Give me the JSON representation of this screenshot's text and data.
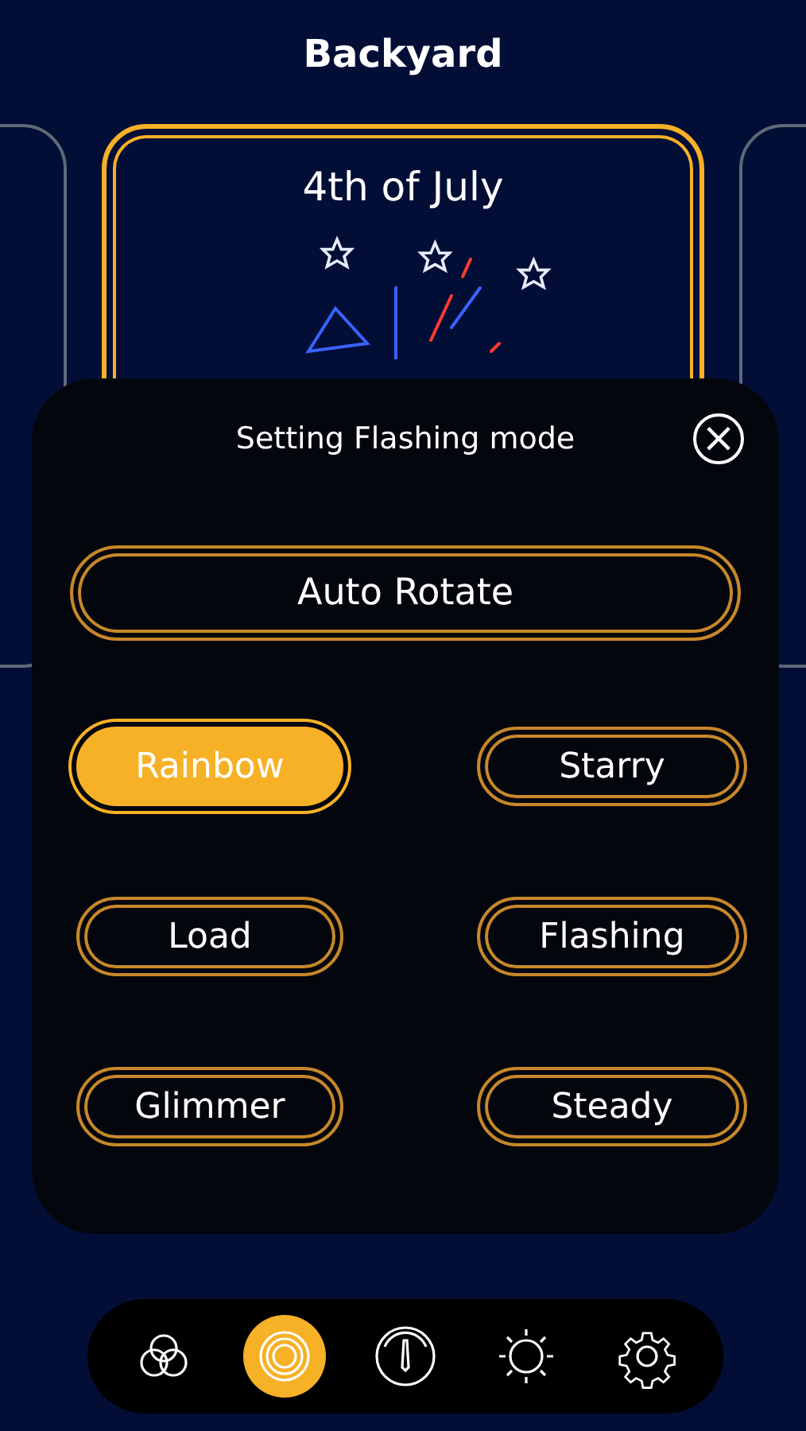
{
  "header": {
    "title": "Backyard"
  },
  "carousel": {
    "cards": [
      {
        "kind": "side"
      },
      {
        "kind": "center",
        "title": "4th of July",
        "selected": true
      },
      {
        "kind": "side"
      }
    ]
  },
  "modal": {
    "title": "Setting Flashing mode",
    "close_icon": "×",
    "primary": {
      "label": "Auto Rotate",
      "selected": false
    },
    "modes": [
      {
        "label": "Rainbow",
        "selected": true
      },
      {
        "label": "Starry",
        "selected": false
      },
      {
        "label": "Load",
        "selected": false
      },
      {
        "label": "Flashing",
        "selected": false
      },
      {
        "label": "Glimmer",
        "selected": false
      },
      {
        "label": "Steady",
        "selected": false
      }
    ]
  },
  "nav": [
    {
      "kind": "colors",
      "selected": false
    },
    {
      "kind": "modes",
      "selected": true
    },
    {
      "kind": "speed",
      "selected": false
    },
    {
      "kind": "brightness",
      "selected": false
    },
    {
      "kind": "settings",
      "selected": false
    }
  ]
}
